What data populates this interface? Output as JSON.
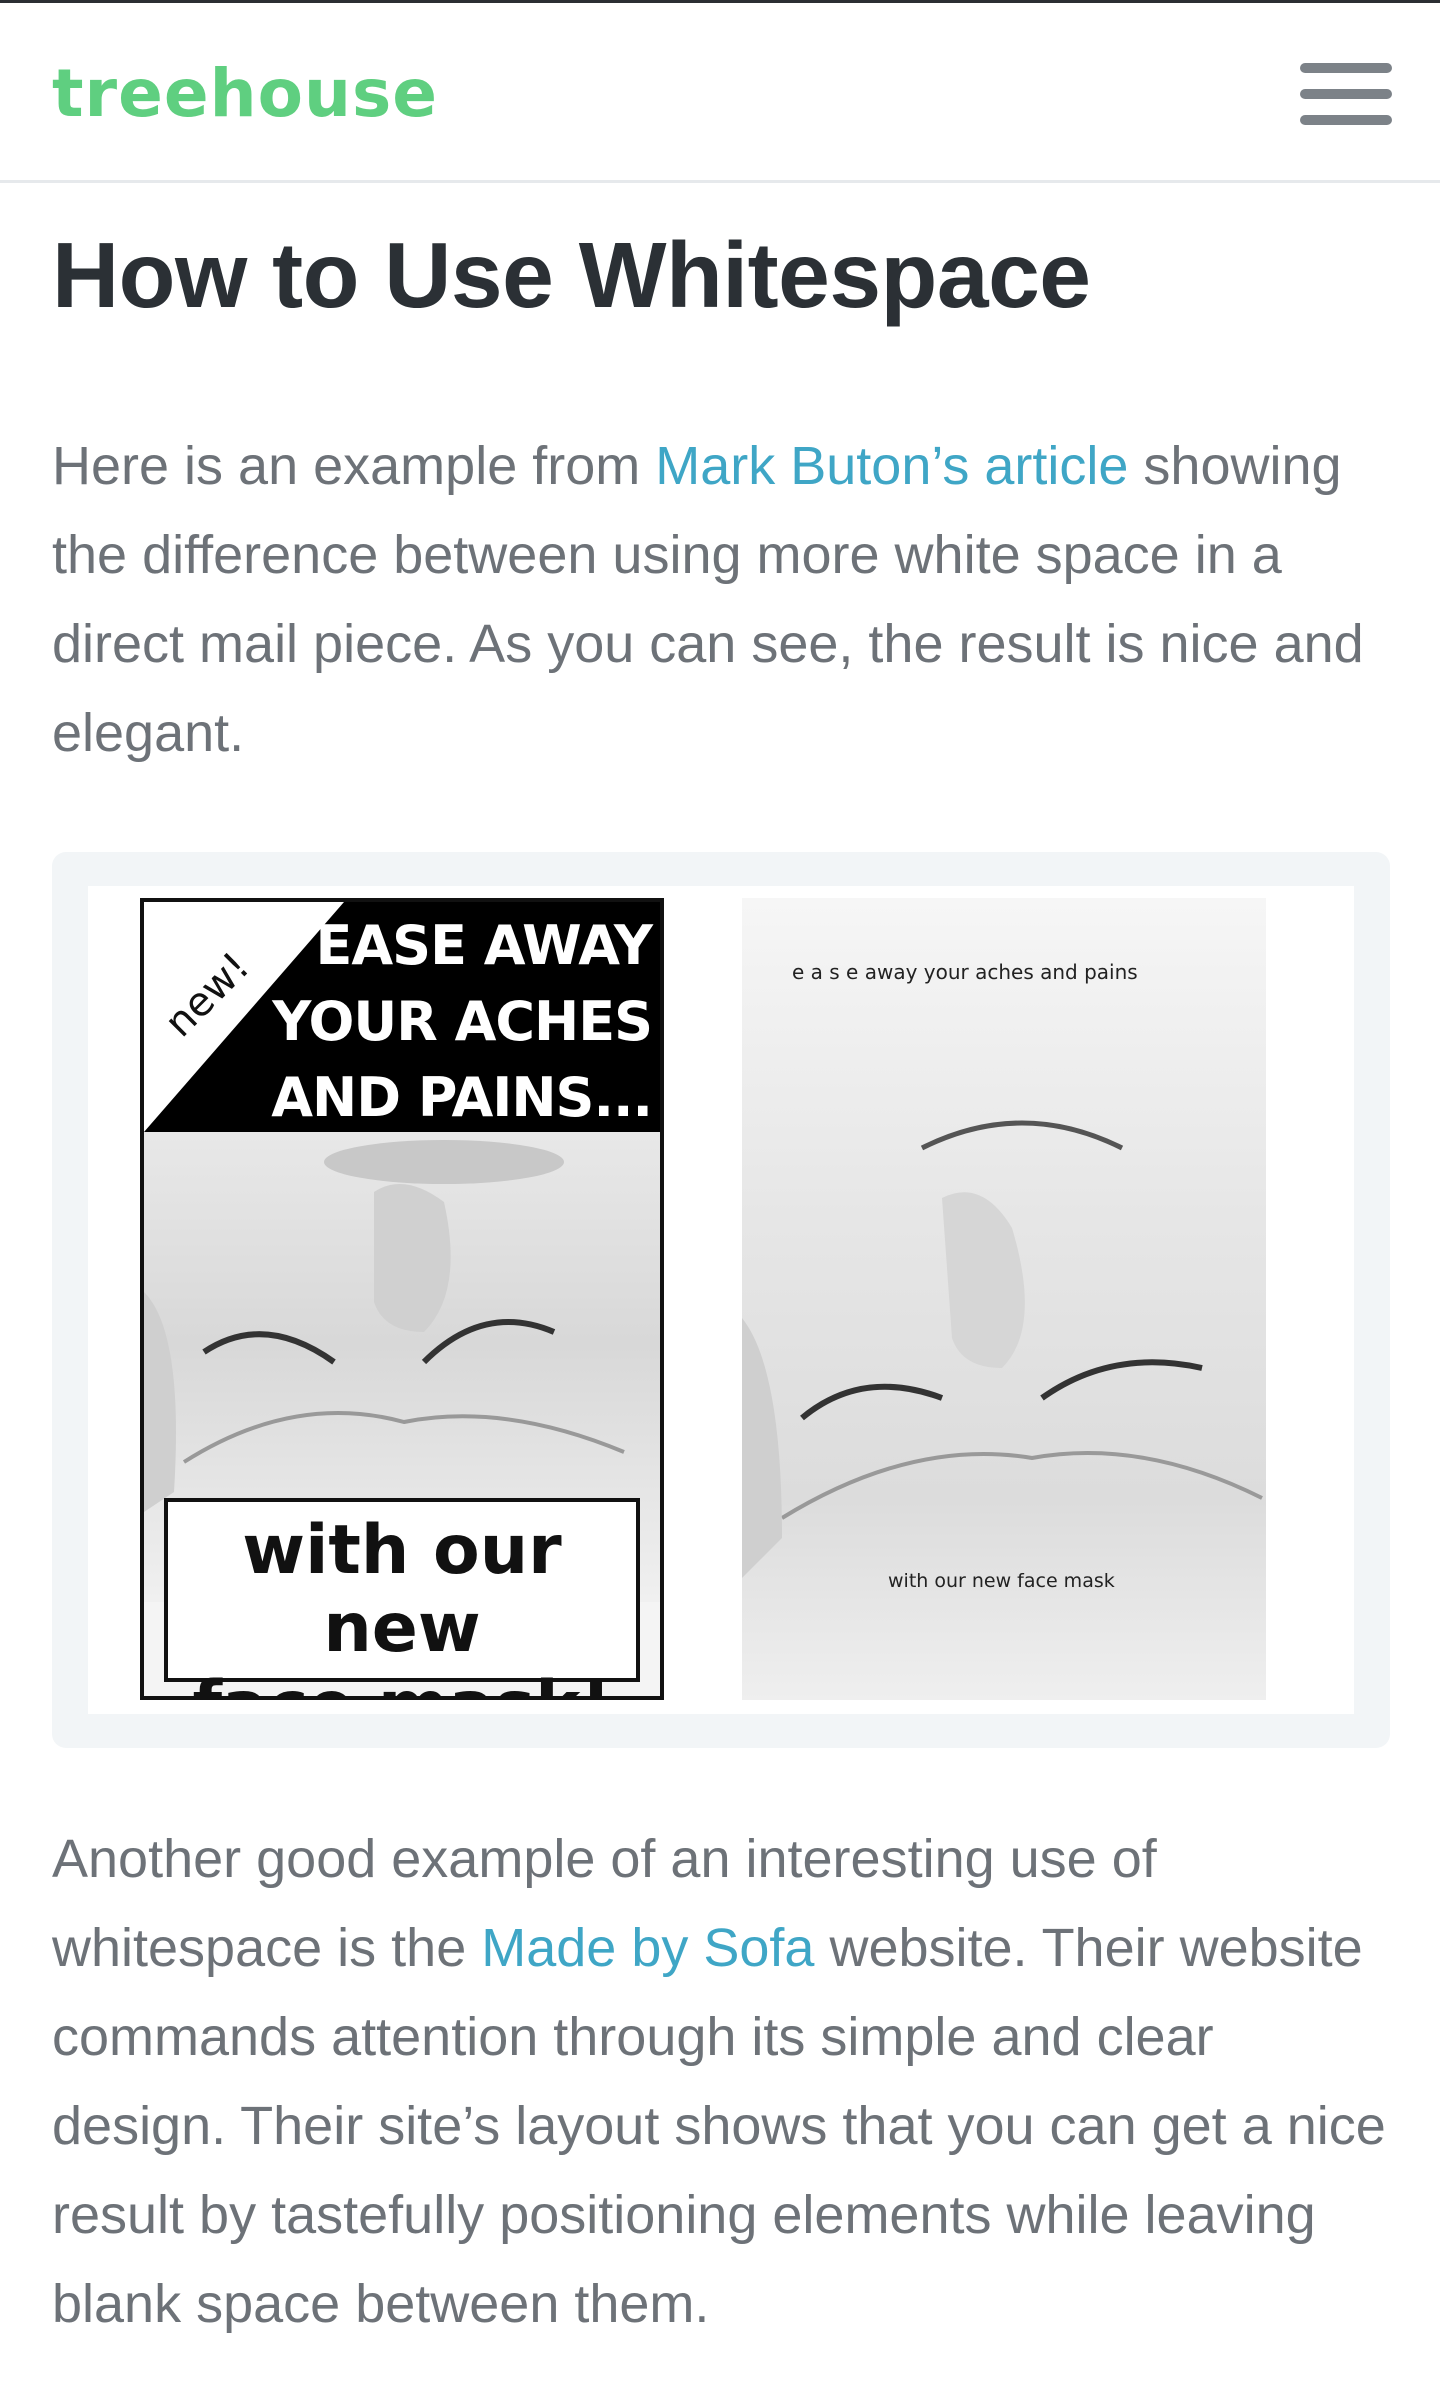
{
  "header": {
    "logo": "treehouse",
    "menu_icon": "hamburger-menu-icon"
  },
  "article": {
    "title": "How to Use Whitespace",
    "paragraph1": {
      "before": "Here is an example from ",
      "link": "Mark Buton’s article",
      "after": " showing the difference between using more white space in a direct mail piece. As you can see, the result is nice and elegant."
    },
    "paragraph2": {
      "before": "Another good example of an interesting use of whitespace is the ",
      "link": "Made by Sofa",
      "after": " website. Their website commands attention through its simple and clear design. Their site’s layout shows that you can get a nice result by tastefully positioning elements while leaving blank space between them."
    }
  },
  "figure": {
    "left_ad": {
      "badge": "new!",
      "headline_line1": "EASE AWAY",
      "headline_line2": "YOUR ACHES",
      "headline_line3": "AND PAINS...",
      "footer_line1": "with our new",
      "footer_line2": "face mask!"
    },
    "right_ad": {
      "headline": "e a s e   away your aches and pains",
      "footer": "with our new face mask"
    }
  },
  "colors": {
    "brand_green": "#5fcf80",
    "link_blue": "#3fa6c6",
    "body_text": "#6d7278",
    "heading": "#2b3035"
  }
}
